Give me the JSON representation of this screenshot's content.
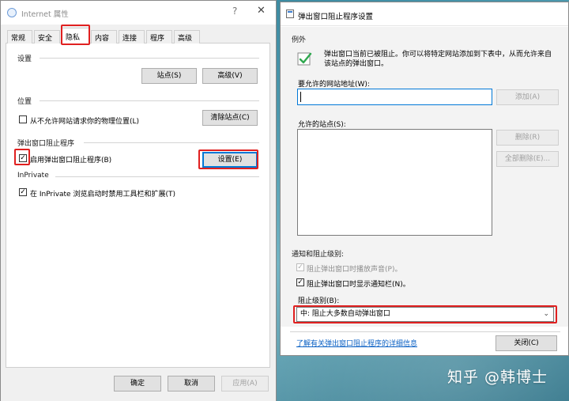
{
  "left_dialog": {
    "title": "Internet 属性",
    "help_glyph": "?",
    "close_glyph": "✕",
    "tabs": [
      {
        "label": "常规"
      },
      {
        "label": "安全"
      },
      {
        "label": "隐私"
      },
      {
        "label": "内容"
      },
      {
        "label": "连接"
      },
      {
        "label": "程序"
      },
      {
        "label": "高级"
      }
    ],
    "active_tab": "隐私",
    "settings_group": "设置",
    "sites_button": "站点(S)",
    "advanced_button": "高级(V)",
    "location_group": "位置",
    "location_checkbox": "从不允许网站请求你的物理位置(L)",
    "location_checked": false,
    "clear_sites_button": "清除站点(C)",
    "popup_group": "弹出窗口阻止程序",
    "popup_checkbox": "启用弹出窗口阻止程序(B)",
    "popup_checked": true,
    "popup_settings_button": "设置(E)",
    "inprivate_group": "InPrivate",
    "inprivate_checkbox": "在 InPrivate 浏览启动时禁用工具栏和扩展(T)",
    "inprivate_checked": true,
    "ok_button": "确定",
    "cancel_button": "取消",
    "apply_button": "应用(A)",
    "check_glyph": "✓"
  },
  "right_dialog": {
    "title": "弹出窗口阻止程序设置",
    "exceptions_group": "例外",
    "exceptions_desc_line1": "弹出窗口当前已被阻止。你可以将特定网站添加到下表中，从而允许来自",
    "exceptions_desc_line2": "该站点的弹出窗口。",
    "address_label": "要允许的网站地址(W):",
    "address_value": "",
    "add_button": "添加(A)",
    "allowed_label": "允许的站点(S):",
    "allowed_sites": [],
    "remove_button": "删除(R)",
    "remove_all_button": "全部删除(E)...",
    "notify_group": "通知和阻止级别:",
    "sound_checkbox": "阻止弹出窗口时播放声音(P)。",
    "sound_checked": true,
    "sound_disabled": true,
    "notify_checkbox": "阻止弹出窗口时显示通知栏(N)。",
    "notify_checked": true,
    "level_label": "阻止级别(B):",
    "level_value": "中: 阻止大多数自动弹出窗口",
    "level_chevron": "⌄",
    "learn_more_link": "了解有关弹出窗口阻止程序的详细信息",
    "close_button": "关闭(C)",
    "check_glyph": "✓"
  },
  "watermark": "知乎 @韩博士",
  "colors": {
    "highlight_red": "#e02020",
    "primary_blue": "#0078d7",
    "link_blue": "#0b61c4",
    "shield_green": "#2fa84f"
  }
}
